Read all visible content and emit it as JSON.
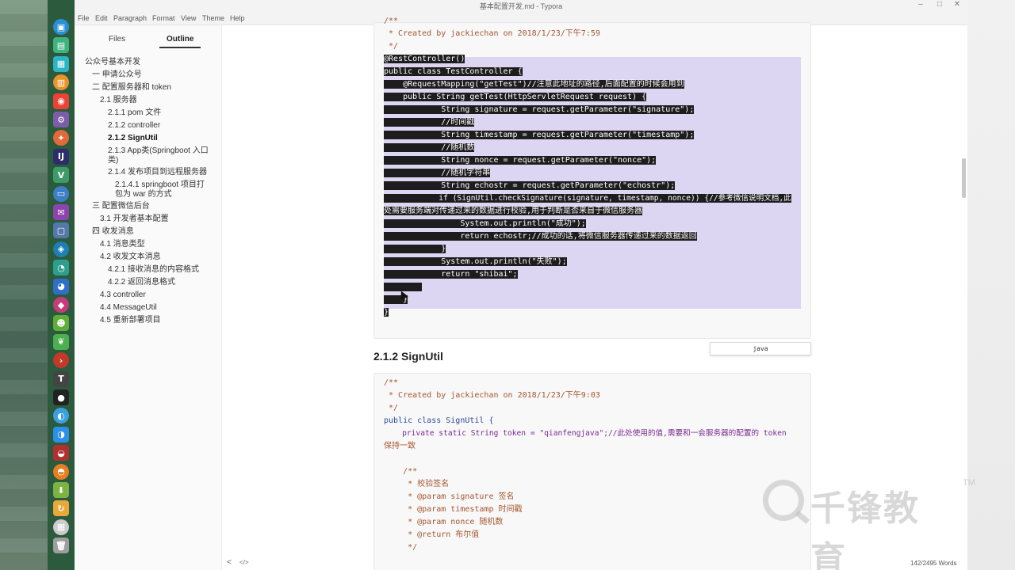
{
  "window": {
    "title": "基本配置开发.md - Typora",
    "controls": [
      "–",
      "□",
      "✕"
    ]
  },
  "menubar": [
    "File",
    "Edit",
    "Paragraph",
    "Format",
    "View",
    "Theme",
    "Help"
  ],
  "sidebar": {
    "tabs": [
      "Files",
      "Outline"
    ],
    "active_tab": "Outline",
    "outline": [
      "公众号基本开发",
      "一 申请公众号",
      "二 配置服务器和 token",
      "2.1 服务器",
      "2.1.1 pom 文件",
      "2.1.2 controller",
      "2.1.2 SignUtil",
      "2.1.3 App类(Springboot 入口类)",
      "2.1.4 发布项目到远程服务器",
      "2.1.4.1 springboot 项目打包为 war 的方式",
      "三 配置微信后台",
      "3.1 开发者基本配置",
      "四 收发消息",
      "4.1 消息类型",
      "4.2 收发文本消息",
      "4.2.1 接收消息的内容格式",
      "4.2.2 返回消息格式",
      "4.3 controller",
      "4.4 MessageUtil",
      "4.5 重新部署项目"
    ],
    "footer": {
      "prev": "<",
      "source": "</>"
    }
  },
  "code_block_1": {
    "lines": [
      "/**",
      " * Created by jackiechan on 2018/1/23/下午7:59",
      " */",
      "@RestController()",
      "public class TestController {",
      "    @RequestMapping(\"getTest\")//注意此地址的路径,后面配置的时候会用到",
      "    public String getTest(HttpServletRequest request) {",
      "            String signature = request.getParameter(\"signature\");",
      "            //时间戳",
      "            String timestamp = request.getParameter(\"timestamp\");",
      "            //随机数",
      "            String nonce = request.getParameter(\"nonce\");",
      "            //随机字符串",
      "            String echostr = request.getParameter(\"echostr\");",
      "            if (SignUtil.checkSignature(signature, timestamp, nonce)) {//参考微信说明文档,此",
      "处需要服务端对传递过来的数据进行校验,用于判断是否来自于微信服务器",
      "                System.out.println(\"成功\");",
      "                return echostr;//成功的话,将微信服务器传递过来的数据返回",
      "            }",
      "            System.out.println(\"失败\");",
      "            return \"shibai\";",
      "        ",
      "    }",
      "}"
    ],
    "language": "java"
  },
  "heading": "2.1.2 SignUtil",
  "code_block_2": {
    "lines": [
      "/**",
      " * Created by jackiechan on 2018/1/23/下午9:03",
      " */",
      "public class SignUtil {",
      "    private static String token = \"qianfengjava\";//此处使用的值,需要和一会服务器的配置的 token",
      "保持一致",
      "",
      "    /**",
      "     * 校验签名",
      "     * @param signature 签名",
      "     * @param timestamp 时间戳",
      "     * @param nonce 随机数",
      "     * @return 布尔值",
      "     */"
    ]
  },
  "statusbar": {
    "word_count": "142/2495 Words"
  },
  "watermark": {
    "text": "千锋教育",
    "tm": "TM"
  },
  "dock_icons": [
    "files-icon",
    "monitor-icon",
    "store-icon",
    "archive-icon",
    "chrome-icon",
    "settings-icon",
    "postman-icon",
    "intellij-icon",
    "vue-icon",
    "window-icon",
    "mail-icon",
    "screen-icon",
    "webstorm-icon",
    "browser-icon",
    "chrome-dev-icon",
    "idea-icon",
    "android-icon",
    "spring-icon",
    "terminal-icon",
    "typora-icon",
    "record-icon",
    "finder-icon",
    "appstore-icon",
    "chrome-canary-icon",
    "firefox-icon",
    "download-icon",
    "sync-icon",
    "calendar-icon",
    "trash-icon"
  ]
}
